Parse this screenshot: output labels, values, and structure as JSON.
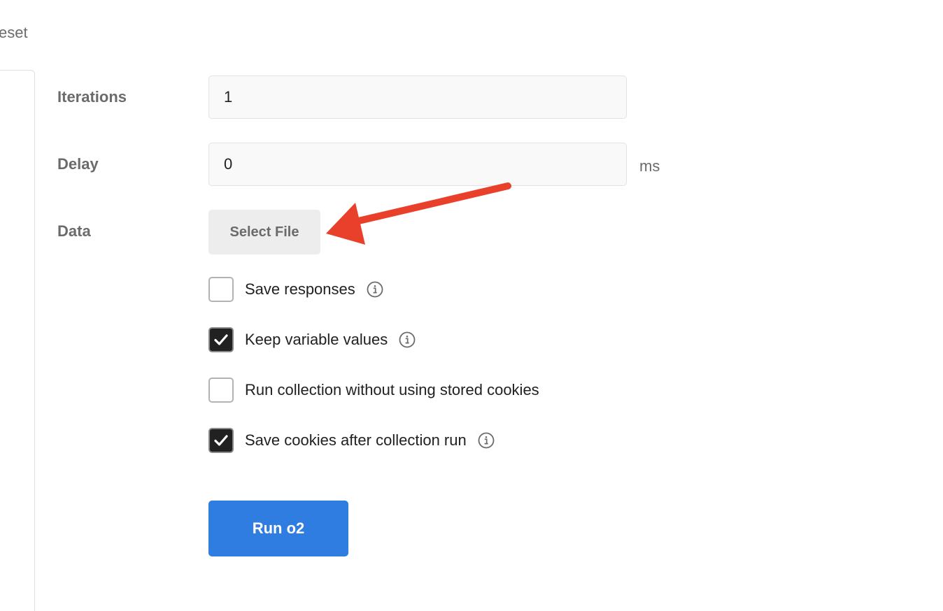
{
  "header": {
    "reset_label": "eset"
  },
  "fields": {
    "iterations": {
      "label": "Iterations",
      "value": "1"
    },
    "delay": {
      "label": "Delay",
      "value": "0",
      "unit": "ms"
    },
    "data": {
      "label": "Data",
      "button_label": "Select File"
    }
  },
  "options": [
    {
      "label": "Save responses",
      "checked": false,
      "has_info": true
    },
    {
      "label": "Keep variable values",
      "checked": true,
      "has_info": true
    },
    {
      "label": "Run collection without using stored cookies",
      "checked": false,
      "has_info": false
    },
    {
      "label": "Save cookies after collection run",
      "checked": true,
      "has_info": true
    }
  ],
  "run_button": {
    "label": "Run o2"
  },
  "icons": {
    "info": "info-circle-icon",
    "check": "checkmark-icon",
    "annotation": "red-arrow-annotation"
  },
  "colors": {
    "primary_button": "#2f7de1",
    "annotation_arrow": "#e8402a",
    "checkbox_checked": "#212121"
  }
}
